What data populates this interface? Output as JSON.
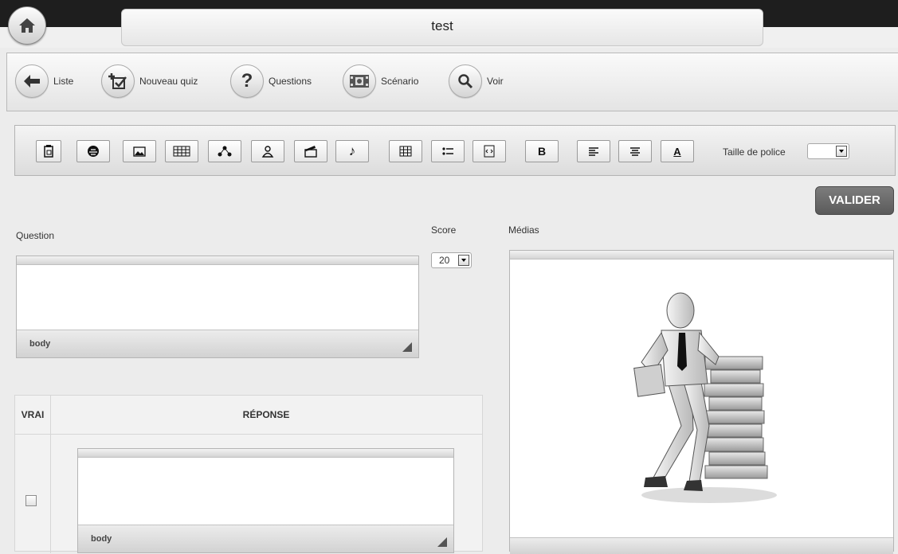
{
  "window": {
    "title": "test"
  },
  "nav": {
    "items": [
      {
        "label": "Liste",
        "icon": "arrow-left-icon"
      },
      {
        "label": "Nouveau quiz",
        "icon": "add-checkbox-icon"
      },
      {
        "label": "Questions",
        "icon": "question-mark-icon"
      },
      {
        "label": "Scénario",
        "icon": "film-icon"
      },
      {
        "label": "Voir",
        "icon": "magnifier-icon"
      }
    ]
  },
  "format_toolbar": {
    "buttons": [
      "paste-word-icon",
      "image-library-icon",
      "image-icon",
      "video-grid-icon",
      "sitemap-icon",
      "award-icon",
      "clapperboard-icon",
      "music-note-icon",
      "table-icon",
      "bullet-list-icon",
      "source-code-icon",
      "bold-icon",
      "align-left-icon",
      "align-center-icon",
      "font-color-icon"
    ],
    "font_size_label": "Taille de police",
    "font_size_value": ""
  },
  "actions": {
    "validate_label": "VALIDER"
  },
  "question": {
    "label": "Question",
    "editor_path": "body"
  },
  "score": {
    "label": "Score",
    "value": "20"
  },
  "media": {
    "label": "Médias",
    "illustration": "businessman-with-books-illustration"
  },
  "answers": {
    "headers": {
      "vrai": "VRAI",
      "reponse": "RÉPONSE"
    },
    "rows": [
      {
        "checked": false,
        "editor_path": "body"
      }
    ]
  },
  "colors": {
    "dark_strip": "#1e1e1e",
    "valider_bg": "#6b6b6b",
    "background": "#ececec"
  }
}
